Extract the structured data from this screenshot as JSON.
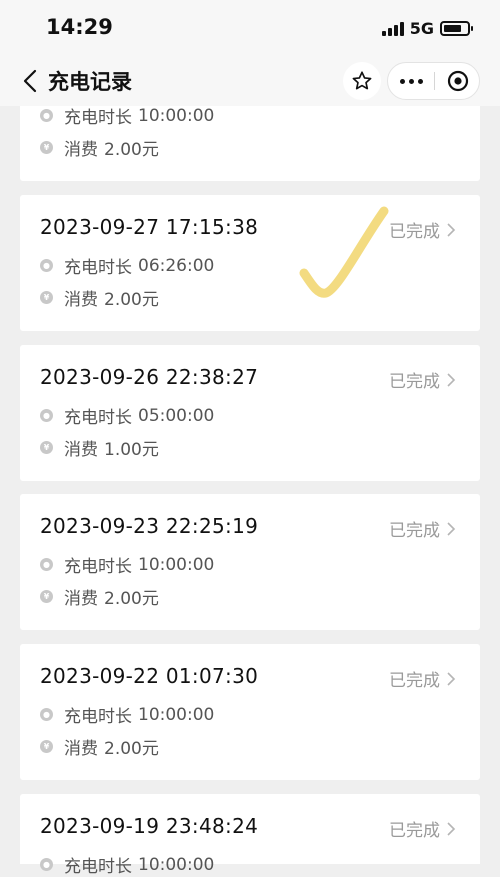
{
  "status_bar": {
    "time": "14:29",
    "network": "5G"
  },
  "nav": {
    "title": "充电记录"
  },
  "labels": {
    "duration": "充电时长",
    "fee": "消费"
  },
  "records": [
    {
      "datetime": "",
      "status": "",
      "duration": "10:00:00",
      "fee": "2.00元"
    },
    {
      "datetime": "2023-09-27 17:15:38",
      "status": "已完成",
      "duration": "06:26:00",
      "fee": "2.00元"
    },
    {
      "datetime": "2023-09-26 22:38:27",
      "status": "已完成",
      "duration": "05:00:00",
      "fee": "1.00元"
    },
    {
      "datetime": "2023-09-23 22:25:19",
      "status": "已完成",
      "duration": "10:00:00",
      "fee": "2.00元"
    },
    {
      "datetime": "2023-09-22 01:07:30",
      "status": "已完成",
      "duration": "10:00:00",
      "fee": "2.00元"
    },
    {
      "datetime": "2023-09-19 23:48:24",
      "status": "已完成",
      "duration": "10:00:00",
      "fee": ""
    }
  ],
  "colors": {
    "background": "#efefef",
    "card": "#ffffff",
    "status_text": "#9a9a9a",
    "check_mark": "#f2d97a"
  },
  "icons": {
    "back": "chevron-left-icon",
    "star": "star-icon",
    "more": "more-dots-icon",
    "close": "mini-program-close-icon",
    "duration": "clock-icon",
    "fee": "yen-icon",
    "row_arrow": "chevron-right-icon",
    "annotation": "check-mark-icon"
  }
}
